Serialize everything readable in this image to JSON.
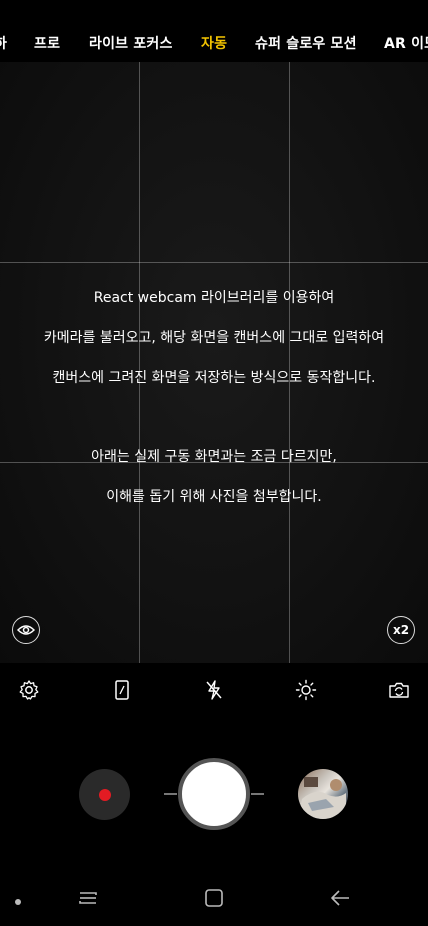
{
  "colors": {
    "accent": "#f2c300",
    "record": "#e31b23"
  },
  "modes": [
    {
      "label": "하"
    },
    {
      "label": "프로"
    },
    {
      "label": "라이브 포커스"
    },
    {
      "label": "자동",
      "active": true
    },
    {
      "label": "슈퍼 슬로우 모션"
    },
    {
      "label": "AR 이모"
    }
  ],
  "overlay_text": [
    "React webcam 라이브러리를 이용하여",
    "카메라를 불러오고, 해당 화면을 캔버스에 그대로 입력하여",
    "캔버스에 그려진 화면을 저장하는 방식으로 동작합니다.",
    "아래는 실제 구동 화면과는 조금 다르지만,",
    "이해를 돕기 위해 사진을 첨부합니다."
  ],
  "viewfinder": {
    "zoom_label": "x2",
    "eye_icon": "eye-icon"
  },
  "tools": [
    "gear-icon",
    "aspect-ratio-icon",
    "flash-off-icon",
    "filter-effect-icon",
    "switch-camera-icon"
  ],
  "capture": {
    "record_icon": "record-dot-icon",
    "shutter_icon": "shutter-icon",
    "gallery_icon": "gallery-thumbnail"
  },
  "navbar": [
    "nav-dot-icon",
    "recent-apps-icon",
    "home-icon",
    "back-icon"
  ]
}
